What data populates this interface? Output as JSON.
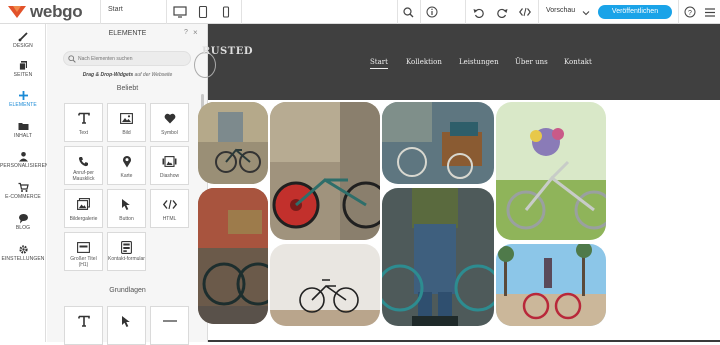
{
  "app": {
    "logo_text": "webgo",
    "page_label": "Start",
    "preview_label": "Vorschau",
    "publish_label": "Veröffentlichen",
    "accent": "#1aa3e8",
    "devices": [
      "desktop-icon",
      "tablet-icon",
      "phone-icon"
    ],
    "tools": [
      "search-icon",
      "info-icon",
      "undo-icon",
      "redo-icon",
      "code-icon",
      "chevron-down-icon",
      "help-icon",
      "menu-icon"
    ]
  },
  "sidebar": {
    "items": [
      {
        "label": "Design",
        "icon": "brush-icon"
      },
      {
        "label": "Seiten",
        "icon": "pages-icon"
      },
      {
        "label": "Elemente",
        "icon": "plus-icon",
        "active": true
      },
      {
        "label": "Inhalt",
        "icon": "folder-icon"
      },
      {
        "label": "Personalisieren",
        "icon": "user-icon"
      },
      {
        "label": "E-Commerce",
        "icon": "cart-icon"
      },
      {
        "label": "Blog",
        "icon": "speech-bubble-icon"
      },
      {
        "label": "Einstellungen",
        "icon": "gear-icon"
      }
    ]
  },
  "panel": {
    "title": "Elemente",
    "help": "?",
    "close": "×",
    "search_placeholder": "Nach Elementen suchen",
    "hint_bold": "Drag & Drop-Widgets",
    "hint_rest": " auf der Webseite",
    "sections": {
      "popular": "Beliebt",
      "basics": "Grundlagen"
    },
    "tiles": [
      {
        "label": "Text",
        "icon": "text-icon"
      },
      {
        "label": "Bild",
        "icon": "image-icon"
      },
      {
        "label": "Symbol",
        "icon": "heart-icon"
      },
      {
        "label": "Anruf-per Mausklick",
        "icon": "phone-call-icon"
      },
      {
        "label": "Karte",
        "icon": "map-pin-icon"
      },
      {
        "label": "Diashow",
        "icon": "slideshow-icon"
      },
      {
        "label": "Bildergalerie",
        "icon": "gallery-icon"
      },
      {
        "label": "Button",
        "icon": "pointer-icon"
      },
      {
        "label": "HTML",
        "icon": "code-icon"
      },
      {
        "label": "Großer Titel (H1)",
        "icon": "title-icon"
      },
      {
        "label": "Kontakt-formular",
        "icon": "form-icon"
      }
    ],
    "basic_tiles": [
      {
        "label": "",
        "icon": "text-icon"
      },
      {
        "label": "",
        "icon": "pointer-icon"
      },
      {
        "label": "",
        "icon": "divider-icon"
      }
    ]
  },
  "site": {
    "brand": "RUSTED",
    "nav": [
      "Start",
      "Kollektion",
      "Leistungen",
      "Über uns",
      "Kontakt"
    ],
    "active_nav": "Start",
    "header_color": "#404040"
  }
}
